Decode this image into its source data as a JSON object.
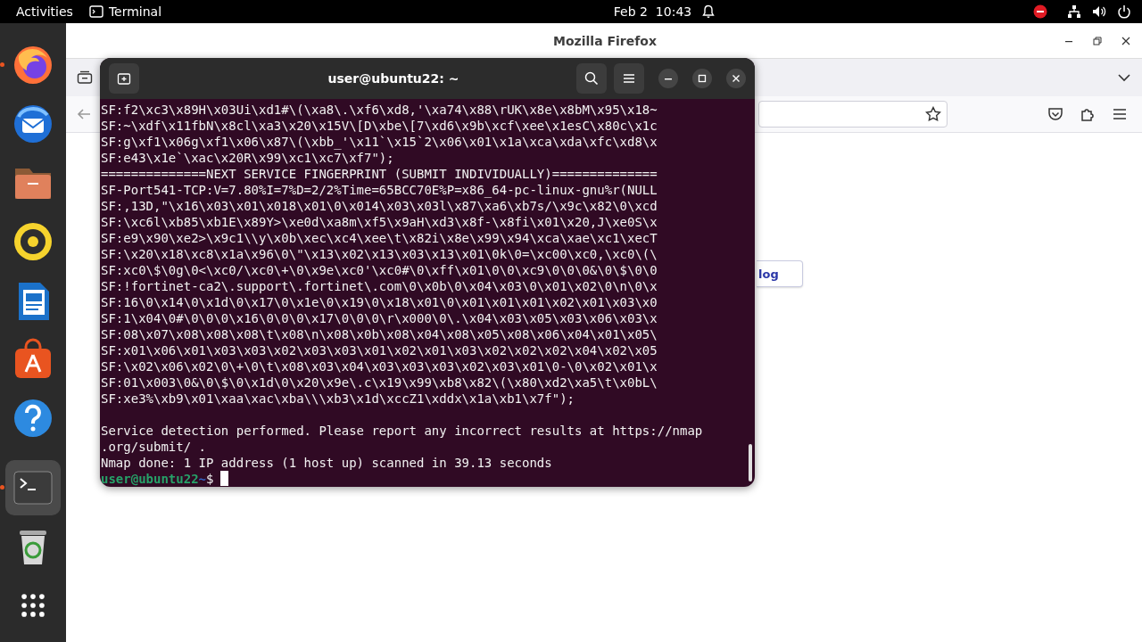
{
  "top_bar": {
    "activities": "Activities",
    "app": "Terminal",
    "clock": "Feb 2  10:43"
  },
  "dock": {
    "items": [
      {
        "kind": "firefox",
        "running": true,
        "active": false
      },
      {
        "kind": "thunderbird",
        "running": false,
        "active": false
      },
      {
        "kind": "files",
        "running": false,
        "active": false
      },
      {
        "kind": "rhythmbox",
        "running": false,
        "active": false
      },
      {
        "kind": "writer",
        "running": false,
        "active": false
      },
      {
        "kind": "appcenter",
        "running": false,
        "active": false
      },
      {
        "kind": "help",
        "running": false,
        "active": false
      },
      {
        "kind": "terminal",
        "running": true,
        "active": true
      },
      {
        "kind": "trash",
        "running": false,
        "active": false
      },
      {
        "kind": "apps",
        "running": false,
        "active": false
      }
    ]
  },
  "browser": {
    "title": "Mozilla Firefox",
    "page_button": "log"
  },
  "terminal": {
    "title": "user@ubuntu22: ~",
    "blocks": [
      [
        "SF:f2\\xc3\\x89H\\x03Ui\\xd1#\\(\\xa8\\.\\xf6\\xd8,'\\xa74\\x88\\rUK\\x8e\\x8bM\\x95\\x18~",
        "SF:~\\xdf\\x11fbN\\x8cl\\xa3\\x20\\x15V\\[D\\xbe\\[7\\xd6\\x9b\\xcf\\xee\\x1esC\\x80c\\x1c",
        "SF:g\\xf1\\x06g\\xf1\\x06\\x87\\(\\xbb_'\\x11`\\x15`2\\x06\\x01\\x1a\\xca\\xda\\xfc\\xd8\\x",
        "SF:e43\\x1e`\\xac\\x20R\\x99\\xc1\\xc7\\xf7\");",
        "==============NEXT SERVICE FINGERPRINT (SUBMIT INDIVIDUALLY)==============",
        "SF-Port541-TCP:V=7.80%I=7%D=2/2%Time=65BCC70E%P=x86_64-pc-linux-gnu%r(NULL",
        "SF:,13D,\"\\x16\\x03\\x01\\x018\\x01\\0\\x014\\x03\\x03l\\x87\\xa6\\xb7s/\\x9c\\x82\\0\\xcd",
        "SF:\\xc6l\\xb85\\xb1E\\x89Y>\\xe0d\\xa8m\\xf5\\x9aH\\xd3\\x8f-\\x8fi\\x01\\x20,J\\xe0S\\x",
        "SF:e9\\x90\\xe2>\\x9c1\\\\y\\x0b\\xec\\xc4\\xee\\t\\x82i\\x8e\\x99\\x94\\xca\\xae\\xc1\\xecT",
        "SF:\\x20\\x18\\xc8\\x1a\\x96\\0\\\"\\x13\\x02\\x13\\x03\\x13\\x01\\0k\\0=\\xc00\\xc0,\\xc0\\(\\",
        "SF:xc0\\$\\0g\\0<\\xc0/\\xc0\\+\\0\\x9e\\xc0'\\xc0#\\0\\xff\\x01\\0\\0\\xc9\\0\\0\\0&\\0\\$\\0\\0",
        "SF:!fortinet-ca2\\.support\\.fortinet\\.com\\0\\x0b\\0\\x04\\x03\\0\\x01\\x02\\0\\n\\0\\x",
        "SF:16\\0\\x14\\0\\x1d\\0\\x17\\0\\x1e\\0\\x19\\0\\x18\\x01\\0\\x01\\x01\\x01\\x02\\x01\\x03\\x0",
        "SF:1\\x04\\0#\\0\\0\\0\\x16\\0\\0\\0\\x17\\0\\0\\0\\r\\x000\\0\\.\\x04\\x03\\x05\\x03\\x06\\x03\\x",
        "SF:08\\x07\\x08\\x08\\x08\\t\\x08\\n\\x08\\x0b\\x08\\x04\\x08\\x05\\x08\\x06\\x04\\x01\\x05\\",
        "SF:x01\\x06\\x01\\x03\\x03\\x02\\x03\\x03\\x01\\x02\\x01\\x03\\x02\\x02\\x02\\x04\\x02\\x05",
        "SF:\\x02\\x06\\x02\\0\\+\\0\\t\\x08\\x03\\x04\\x03\\x03\\x03\\x02\\x03\\x01\\0-\\0\\x02\\x01\\x",
        "SF:01\\x003\\0&\\0\\$\\0\\x1d\\0\\x20\\x9e\\.c\\x19\\x99\\xb8\\x82\\(\\x80\\xd2\\xa5\\t\\x0bL\\",
        "SF:xe3%\\xb9\\x01\\xaa\\xac\\xba\\\\\\xb3\\x1d\\xccZ1\\xddx\\x1a\\xb1\\x7f\");"
      ],
      [
        "Service detection performed. Please report any incorrect results at https://nmap",
        ".org/submit/ .",
        "Nmap done: 1 IP address (1 host up) scanned in 39.13 seconds"
      ]
    ],
    "prompt": {
      "user_host": "user@ubuntu22",
      "path": "~",
      "symbol": "$"
    }
  }
}
